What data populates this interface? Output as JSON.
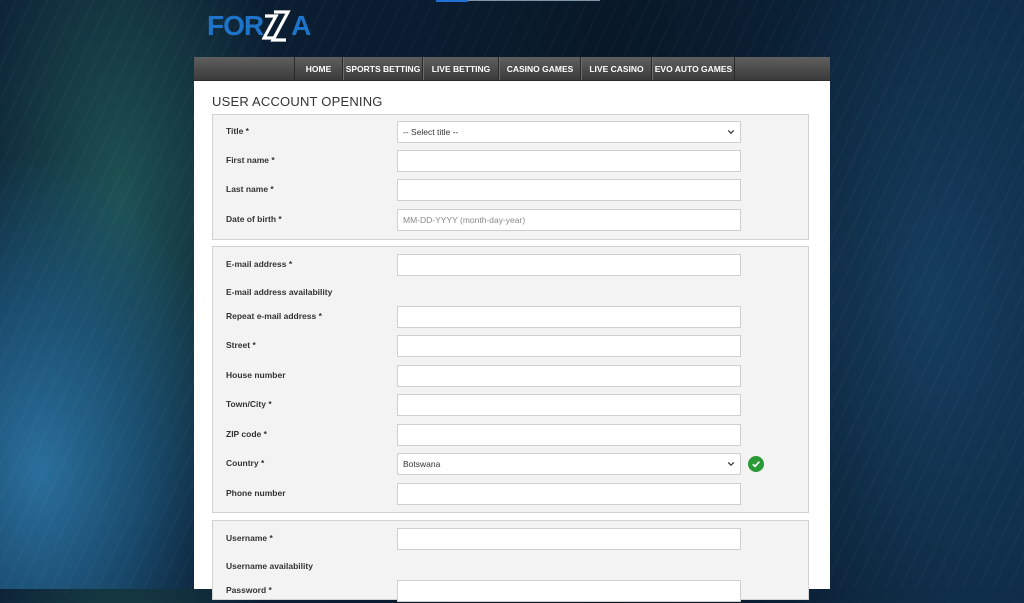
{
  "brand": {
    "logo_text_left": "FOR",
    "logo_text_right": "A"
  },
  "nav": {
    "items": [
      {
        "label": "HOME"
      },
      {
        "label": "SPORTS BETTING"
      },
      {
        "label": "LIVE BETTING"
      },
      {
        "label": "CASINO GAMES"
      },
      {
        "label": "LIVE CASINO"
      },
      {
        "label": "EVO AUTO GAMES"
      }
    ]
  },
  "page": {
    "title": "USER ACCOUNT OPENING"
  },
  "personal": {
    "title_label": "Title *",
    "title_selected": "-- Select title --",
    "first_name_label": "First name *",
    "last_name_label": "Last name *",
    "dob_label": "Date of birth *",
    "dob_placeholder": "MM-DD-YYYY (month-day-year)"
  },
  "contact": {
    "email_label": "E-mail address *",
    "email_availability_label": "E-mail address availability",
    "repeat_email_label": "Repeat e-mail address *",
    "street_label": "Street *",
    "house_number_label": "House number",
    "town_label": "Town/City *",
    "zip_label": "ZIP code *",
    "country_label": "Country *",
    "country_selected": "Botswana",
    "phone_label": "Phone number"
  },
  "account": {
    "username_label": "Username *",
    "username_availability_label": "Username availability",
    "password_label": "Password *"
  },
  "colors": {
    "accent": "#1d74c9",
    "valid": "#2a9a37",
    "nav_bg": "#4a4a4a"
  }
}
